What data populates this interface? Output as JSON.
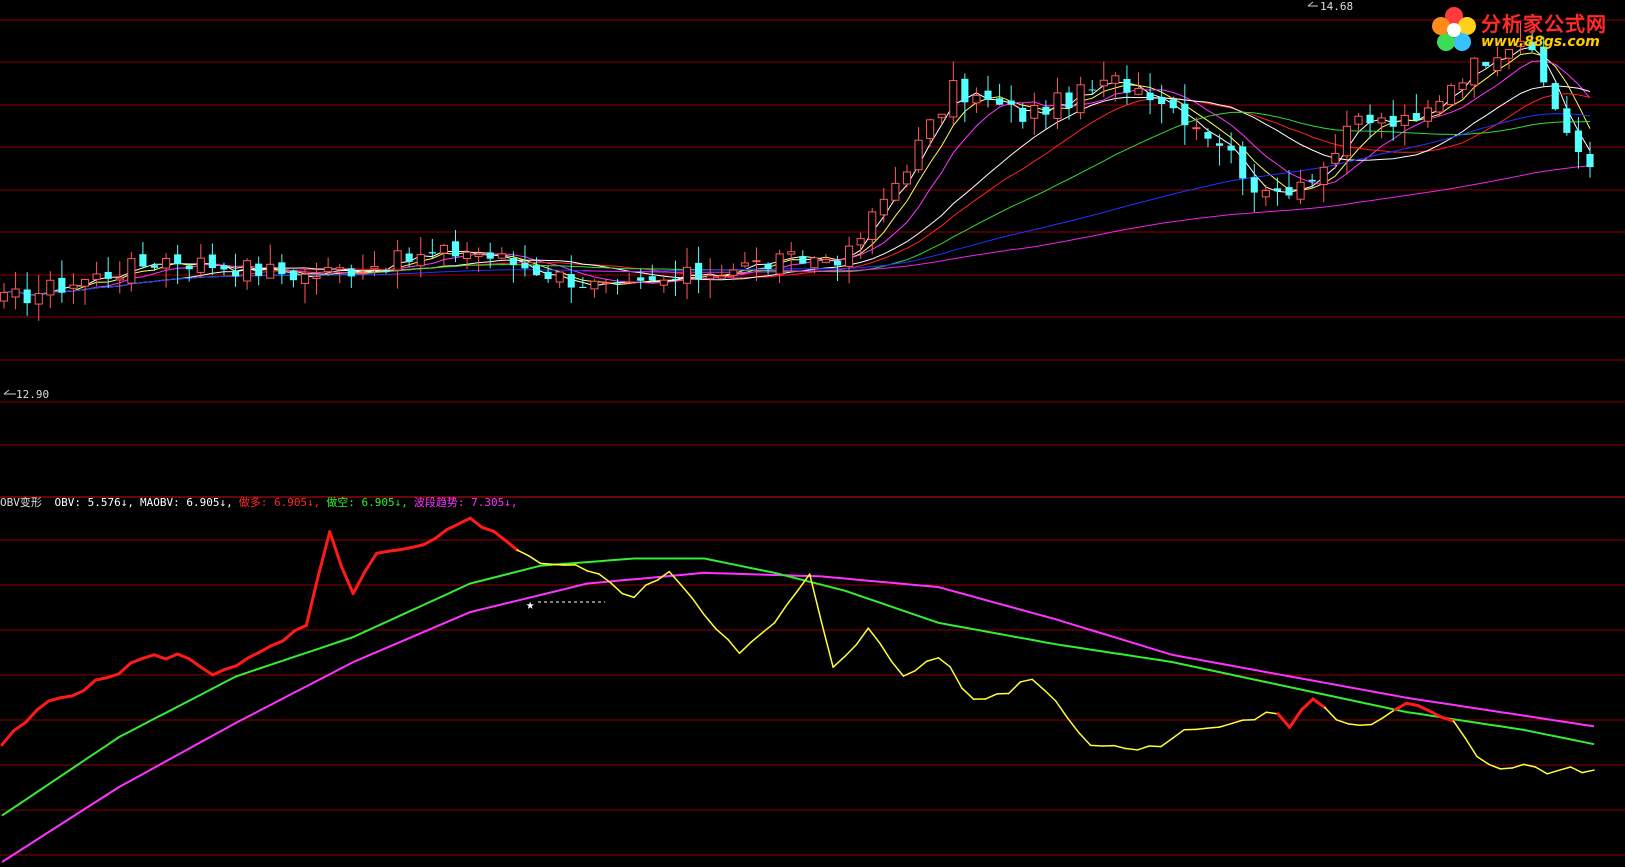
{
  "logo": {
    "title": "分析家公式网",
    "url": "www.88gs.com",
    "icon": "flower-logo-icon"
  },
  "colors": {
    "background": "#000000",
    "grid": "#8b0000",
    "divider": "#cc1111",
    "candle_up": "#ff5a5a",
    "candle_down": "#54ffff",
    "ma_white": "#ffffff",
    "ma_yellow": "#ffff55",
    "ma_magenta": "#ff33ff",
    "ma_red": "#ff2222",
    "ma_green": "#33dd33",
    "ma_blue": "#2233ff",
    "ma_purple": "#ee22ee",
    "obv_bull": "#ff1a1a",
    "obv_bear": "#ffff33",
    "maobv": "#33ee33",
    "trend": "#ff33ff"
  },
  "price_panel": {
    "high_label": "14.68",
    "low_label": "12.90"
  },
  "indicator": {
    "name": "OBV变形",
    "items": [
      {
        "label": "OBV:",
        "value": "5.576↓",
        "color": "#ffffff"
      },
      {
        "label": "MAOBV:",
        "value": "6.905↓",
        "color": "#ffffff"
      },
      {
        "label": "做多:",
        "value": "6.905↓",
        "color": "#ff2a2a"
      },
      {
        "label": "做空:",
        "value": "6.905↓",
        "color": "#33ee33"
      },
      {
        "label": "波段趋势:",
        "value": "7.305↓",
        "color": "#ff33ff"
      }
    ]
  },
  "chart_data": [
    {
      "type": "candlestick",
      "panel": "price",
      "ylim": [
        11.9,
        14.8
      ],
      "labeled_points": {
        "high": 14.68,
        "low": 12.9
      },
      "candles_count": 138,
      "keys": [
        [
          0,
          13.05
        ],
        [
          14,
          13.3
        ],
        [
          26,
          13.2
        ],
        [
          40,
          13.35
        ],
        [
          53,
          13.1
        ],
        [
          63,
          13.25
        ],
        [
          73,
          13.32
        ],
        [
          82,
          14.3
        ],
        [
          88,
          14.15
        ],
        [
          96,
          14.35
        ],
        [
          99,
          14.3
        ],
        [
          105,
          14.0
        ],
        [
          109,
          13.65
        ],
        [
          114,
          13.85
        ],
        [
          117,
          14.12
        ],
        [
          122,
          14.1
        ],
        [
          125,
          14.35
        ],
        [
          129,
          14.55
        ],
        [
          131,
          14.62
        ],
        [
          134,
          14.2
        ],
        [
          137,
          13.8
        ]
      ]
    },
    {
      "type": "line",
      "panel": "indicator",
      "series": [
        {
          "name": "OBV",
          "color_bull": "#ff1a1a",
          "color_bear": "#ffff33",
          "bull_segments": [
            [
              0,
              43
            ],
            [
              109,
              112
            ],
            [
              119,
              123
            ]
          ],
          "keys": [
            [
              0,
              0.33
            ],
            [
              4,
              0.45
            ],
            [
              8,
              0.5
            ],
            [
              12,
              0.57
            ],
            [
              15,
              0.58
            ],
            [
              18,
              0.53
            ],
            [
              22,
              0.58
            ],
            [
              26,
              0.66
            ],
            [
              28,
              0.92
            ],
            [
              30,
              0.75
            ],
            [
              32,
              0.86
            ],
            [
              36,
              0.88
            ],
            [
              40,
              0.97
            ],
            [
              42,
              0.92
            ],
            [
              46,
              0.84
            ],
            [
              50,
              0.82
            ],
            [
              54,
              0.74
            ],
            [
              57,
              0.82
            ],
            [
              60,
              0.7
            ],
            [
              63,
              0.58
            ],
            [
              66,
              0.67
            ],
            [
              69,
              0.8
            ],
            [
              71,
              0.55
            ],
            [
              74,
              0.65
            ],
            [
              77,
              0.52
            ],
            [
              80,
              0.58
            ],
            [
              83,
              0.45
            ],
            [
              86,
              0.48
            ],
            [
              88,
              0.52
            ],
            [
              90,
              0.45
            ],
            [
              93,
              0.33
            ],
            [
              96,
              0.32
            ],
            [
              99,
              0.33
            ],
            [
              102,
              0.38
            ],
            [
              104,
              0.38
            ],
            [
              107,
              0.4
            ],
            [
              109,
              0.42
            ],
            [
              110,
              0.38
            ],
            [
              112,
              0.46
            ],
            [
              114,
              0.4
            ],
            [
              116,
              0.38
            ],
            [
              118,
              0.4
            ],
            [
              120,
              0.44
            ],
            [
              122,
              0.42
            ],
            [
              124,
              0.4
            ],
            [
              126,
              0.3
            ],
            [
              128,
              0.26
            ],
            [
              130,
              0.28
            ],
            [
              132,
              0.25
            ],
            [
              134,
              0.26
            ],
            [
              136,
              0.25
            ]
          ]
        },
        {
          "name": "MAOBV",
          "color": "#33ee33",
          "keys": [
            [
              0,
              0.13
            ],
            [
              10,
              0.35
            ],
            [
              20,
              0.52
            ],
            [
              30,
              0.63
            ],
            [
              40,
              0.78
            ],
            [
              46,
              0.83
            ],
            [
              54,
              0.85
            ],
            [
              60,
              0.85
            ],
            [
              66,
              0.81
            ],
            [
              72,
              0.76
            ],
            [
              80,
              0.67
            ],
            [
              90,
              0.61
            ],
            [
              100,
              0.56
            ],
            [
              110,
              0.49
            ],
            [
              120,
              0.42
            ],
            [
              130,
              0.37
            ],
            [
              136,
              0.33
            ]
          ]
        },
        {
          "name": "波段趋势",
          "color": "#ff33ff",
          "keys": [
            [
              0,
              0.0
            ],
            [
              10,
              0.21
            ],
            [
              20,
              0.39
            ],
            [
              30,
              0.56
            ],
            [
              40,
              0.7
            ],
            [
              50,
              0.78
            ],
            [
              60,
              0.81
            ],
            [
              70,
              0.8
            ],
            [
              80,
              0.77
            ],
            [
              90,
              0.68
            ],
            [
              100,
              0.58
            ],
            [
              110,
              0.52
            ],
            [
              120,
              0.46
            ],
            [
              130,
              0.41
            ],
            [
              136,
              0.38
            ]
          ]
        }
      ]
    }
  ]
}
